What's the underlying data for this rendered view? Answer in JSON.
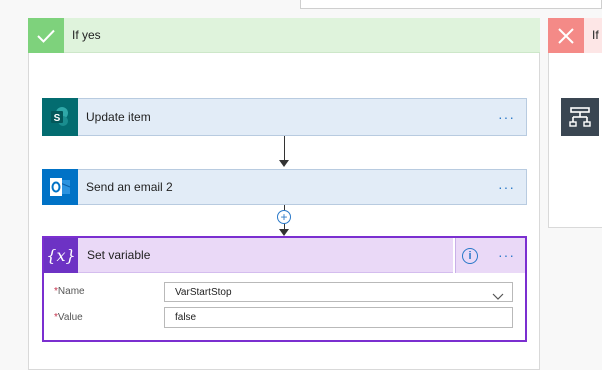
{
  "yes_branch": {
    "label": "If yes"
  },
  "no_branch": {
    "label": "If"
  },
  "actions": [
    {
      "title": "Update item",
      "icon": "sharepoint-icon",
      "menu": "···",
      "color": "#036c70"
    },
    {
      "title": "Send an email 2",
      "icon": "outlook-icon",
      "menu": "···",
      "color": "#0072c6"
    }
  ],
  "add_step": {
    "symbol": "+"
  },
  "set_variable": {
    "title": "Set variable",
    "icon_text": "{x}",
    "info_symbol": "i",
    "menu": "···",
    "accent": "#7b2fd0",
    "fields": {
      "name": {
        "label": "Name",
        "required_mark": "*",
        "value": "VarStartStop"
      },
      "value": {
        "label": "Value",
        "required_mark": "*",
        "value": "false"
      }
    }
  }
}
